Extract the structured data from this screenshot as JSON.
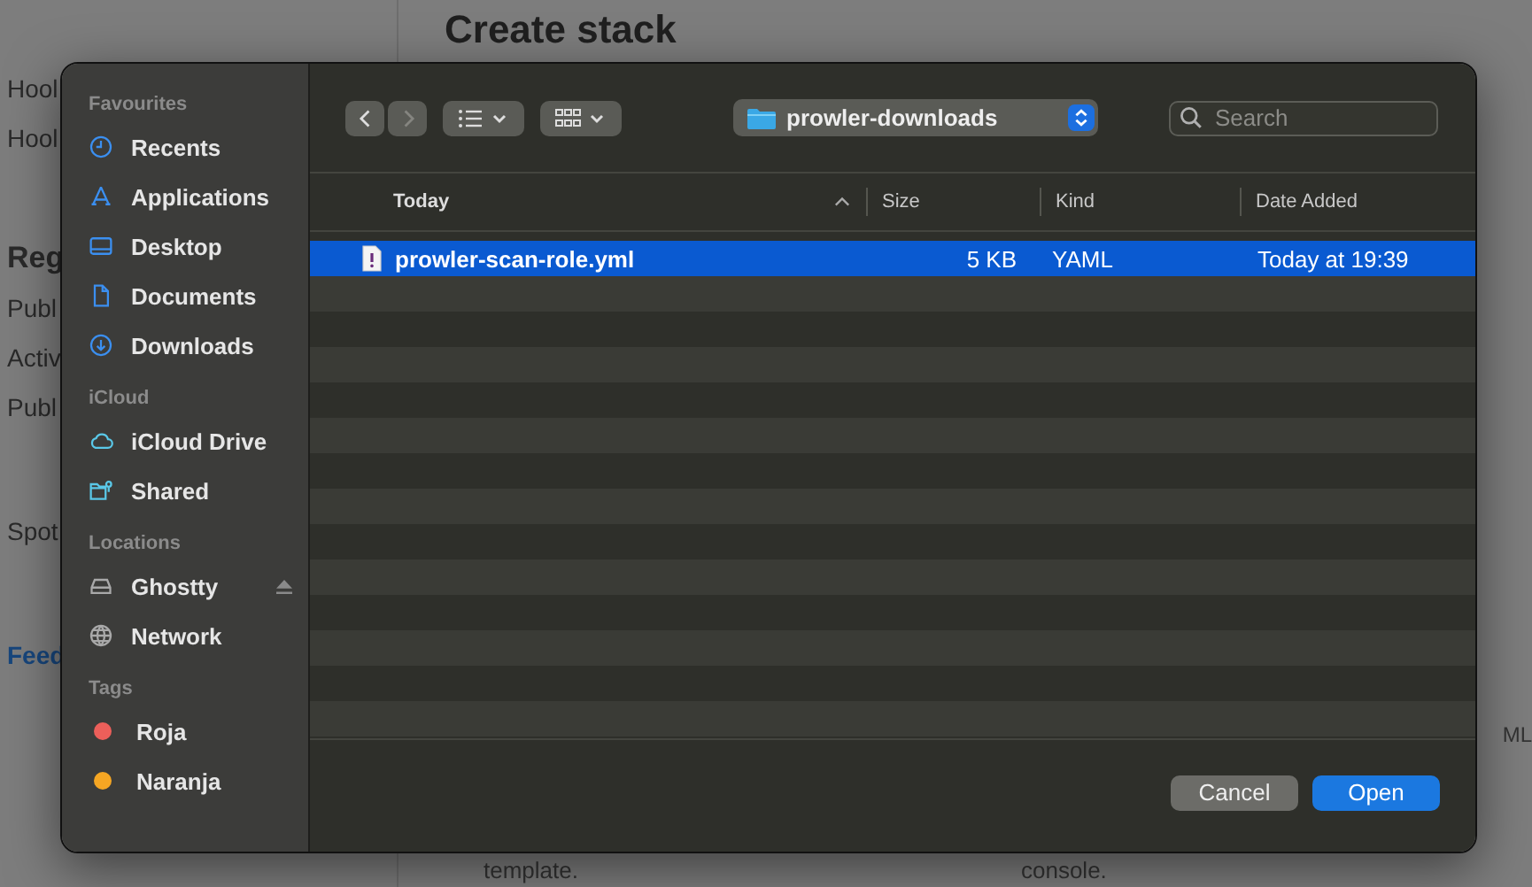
{
  "background_page": {
    "title": "Create stack",
    "left_items": [
      {
        "text": "Hool",
        "kind": "normal"
      },
      {
        "text": "Hool",
        "kind": "normal"
      },
      {
        "text": "Reg",
        "kind": "heading"
      },
      {
        "text": "Publ",
        "kind": "normal"
      },
      {
        "text": "Activ",
        "kind": "normal"
      },
      {
        "text": "Publ",
        "kind": "normal"
      },
      {
        "text": "Spot",
        "kind": "normal"
      },
      {
        "text": "Feed",
        "kind": "link"
      }
    ],
    "right_texts": [
      "ML",
      "template.",
      "console."
    ]
  },
  "dialog": {
    "toolbar": {
      "back_disabled": false,
      "forward_disabled": true,
      "location": "prowler-downloads",
      "search_placeholder": "Search"
    },
    "sidebar": [
      {
        "heading": "Favourites",
        "items": [
          {
            "label": "Recents",
            "kind": "clock"
          },
          {
            "label": "Applications",
            "kind": "apps"
          },
          {
            "label": "Desktop",
            "kind": "desktop"
          },
          {
            "label": "Documents",
            "kind": "document"
          },
          {
            "label": "Downloads",
            "kind": "download"
          }
        ]
      },
      {
        "heading": "iCloud",
        "items": [
          {
            "label": "iCloud Drive",
            "kind": "cloud"
          },
          {
            "label": "Shared",
            "kind": "shared"
          }
        ]
      },
      {
        "heading": "Locations",
        "items": [
          {
            "label": "Ghostty",
            "kind": "drive",
            "ejectable": true
          },
          {
            "label": "Network",
            "kind": "globe"
          }
        ]
      },
      {
        "heading": "Tags",
        "items": [
          {
            "label": "Roja",
            "kind": "tag",
            "color": "#ec5f5a"
          },
          {
            "label": "Naranja",
            "kind": "tag",
            "color": "#f5a623"
          }
        ]
      }
    ],
    "columns": [
      {
        "label": "Today",
        "sorted": true
      },
      {
        "label": "Size",
        "sorted": false
      },
      {
        "label": "Kind",
        "sorted": false
      },
      {
        "label": "Date Added",
        "sorted": false
      }
    ],
    "files": [
      {
        "name": "prowler-scan-role.yml",
        "size": "5 KB",
        "kind": "YAML",
        "date_added": "Today at 19:39",
        "selected": true
      }
    ],
    "buttons": [
      {
        "label": "Cancel",
        "kind": "secondary"
      },
      {
        "label": "Open",
        "kind": "primary"
      }
    ]
  }
}
